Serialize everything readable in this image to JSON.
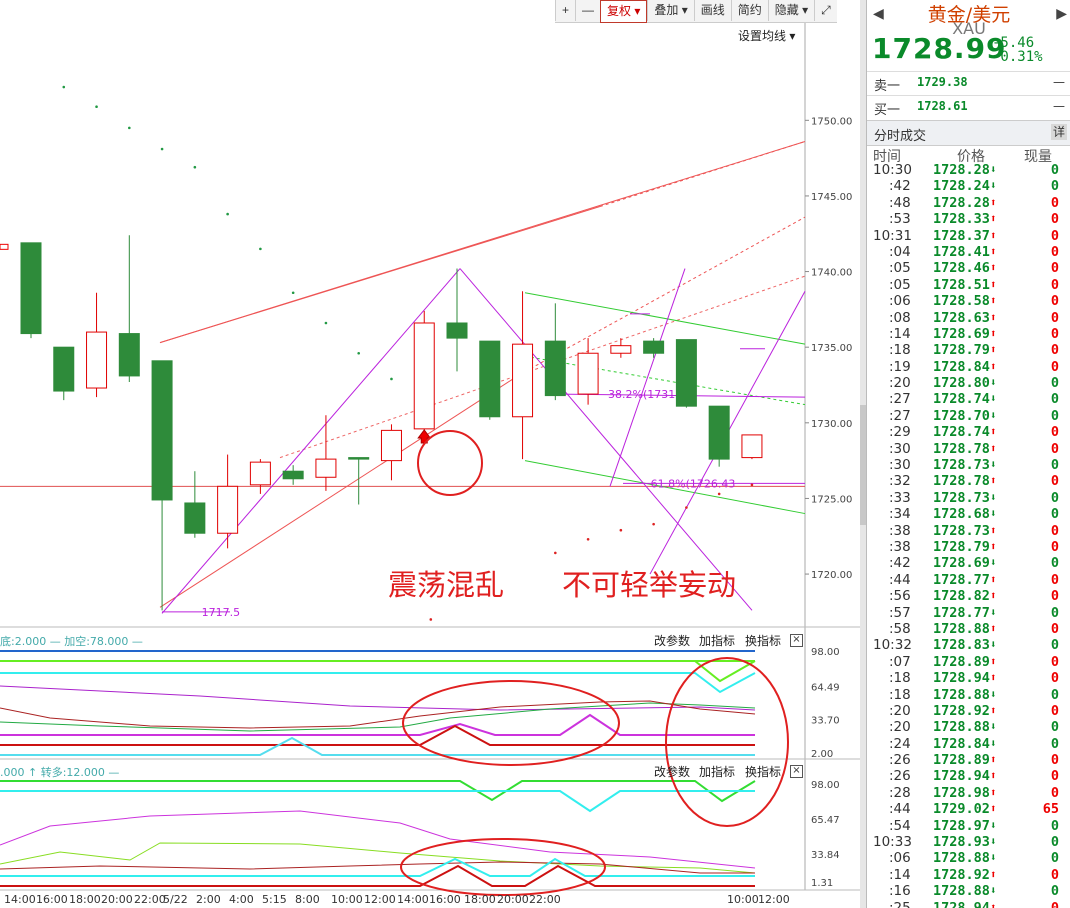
{
  "toolbar": {
    "items": [
      {
        "label": "+",
        "name": "zoom-in-button"
      },
      {
        "label": "—",
        "name": "zoom-out-button"
      },
      {
        "label": "复权 ▾",
        "name": "fuquan-button",
        "active": true
      },
      {
        "label": "叠加 ▾",
        "name": "overlay-button"
      },
      {
        "label": "画线",
        "name": "draw-line-button"
      },
      {
        "label": "简约",
        "name": "simple-button"
      },
      {
        "label": "隐藏 ▾",
        "name": "hide-button"
      },
      {
        "label": "⤢",
        "name": "fullscreen-icon"
      }
    ],
    "ma_setting": "设置均线 ▾"
  },
  "annotation_text": {
    "left": "震荡混乱",
    "right": "不可轻举妄动"
  },
  "chart_data": [
    {
      "type": "candlestick",
      "y_axis_ticks": [
        "1750.00",
        "1745.00",
        "1740.00",
        "1735.00",
        "1730.00",
        "1725.00",
        "1720.00"
      ],
      "ylim": [
        1716.5,
        1756.5
      ],
      "y_tick_values": [
        1750,
        1745,
        1740,
        1735,
        1730,
        1725,
        1720
      ],
      "candles": [
        {
          "o": 1741.9,
          "c": 1735.9,
          "h": 1741.9,
          "l": 1735.6
        },
        {
          "o": 1735.0,
          "c": 1732.1,
          "h": 1735.0,
          "l": 1731.5
        },
        {
          "o": 1732.3,
          "c": 1736.0,
          "h": 1738.6,
          "l": 1731.7
        },
        {
          "o": 1735.9,
          "c": 1733.1,
          "h": 1742.4,
          "l": 1732.7
        },
        {
          "o": 1734.1,
          "c": 1724.9,
          "h": 1734.1,
          "l": 1717.6
        },
        {
          "o": 1724.7,
          "c": 1722.7,
          "h": 1726.8,
          "l": 1722.4
        },
        {
          "o": 1722.7,
          "c": 1725.8,
          "h": 1727.9,
          "l": 1721.7
        },
        {
          "o": 1725.9,
          "c": 1727.4,
          "h": 1727.6,
          "l": 1725.3
        },
        {
          "o": 1726.8,
          "c": 1726.3,
          "h": 1727.2,
          "l": 1725.9
        },
        {
          "o": 1726.4,
          "c": 1727.6,
          "h": 1730.5,
          "l": 1725.5
        },
        {
          "o": 1727.7,
          "c": 1727.6,
          "h": 1727.7,
          "l": 1724.6
        },
        {
          "o": 1727.5,
          "c": 1729.5,
          "h": 1729.9,
          "l": 1726.2
        },
        {
          "o": 1729.6,
          "c": 1736.6,
          "h": 1737.4,
          "l": 1729.2
        },
        {
          "o": 1736.6,
          "c": 1735.6,
          "h": 1740.2,
          "l": 1733.4
        },
        {
          "o": 1735.4,
          "c": 1730.4,
          "h": 1735.4,
          "l": 1730.2
        },
        {
          "o": 1730.4,
          "c": 1735.2,
          "h": 1738.7,
          "l": 1727.6
        },
        {
          "o": 1735.4,
          "c": 1731.8,
          "h": 1737.9,
          "l": 1731.5
        },
        {
          "o": 1731.9,
          "c": 1734.6,
          "h": 1735.6,
          "l": 1731.2
        },
        {
          "o": 1734.6,
          "c": 1735.1,
          "h": 1735.6,
          "l": 1734.3
        },
        {
          "o": 1735.4,
          "c": 1734.6,
          "h": 1735.6,
          "l": 1734.3
        },
        {
          "o": 1735.5,
          "c": 1731.1,
          "h": 1735.5,
          "l": 1731.0
        },
        {
          "o": 1731.1,
          "c": 1727.6,
          "h": 1731.1,
          "l": 1727.1
        },
        {
          "o": 1727.7,
          "c": 1729.2,
          "h": 1729.2,
          "l": 1727.6
        }
      ],
      "sar_points": [
        [
          1,
          1752.2
        ],
        [
          2,
          1750.9
        ],
        [
          3,
          1749.5
        ],
        [
          4,
          1748.1
        ],
        [
          5,
          1746.9
        ],
        [
          6,
          1743.8
        ],
        [
          7,
          1741.5
        ],
        [
          8,
          1738.6
        ],
        [
          9,
          1736.6
        ],
        [
          10,
          1734.6
        ],
        [
          11,
          1732.9
        ],
        [
          12,
          1731.6
        ],
        [
          16,
          1721.4
        ],
        [
          17,
          1722.3
        ],
        [
          18,
          1722.9
        ],
        [
          19,
          1723.3
        ],
        [
          20,
          1724.4
        ],
        [
          21,
          1725.3
        ],
        [
          22,
          1725.9
        ]
      ],
      "horizontal_line": 1725.8,
      "texts": [
        {
          "text": "1717.5",
          "anchor": [
            5.3,
            1717.5
          ]
        },
        {
          "text": "38.2%(1731.7",
          "anchor": [
            17.7,
            1731.9
          ]
        },
        {
          "text": "61.8%(1726.43",
          "anchor": [
            19.0,
            1726.0
          ]
        }
      ]
    },
    {
      "type": "line",
      "title": "底:2.000 — 加空:78.000 —",
      "y_axis_ticks": [
        "98.00",
        "64.49",
        "33.70",
        "2.00"
      ],
      "buttons": [
        "改参数",
        "加指标",
        "换指标"
      ]
    },
    {
      "type": "line",
      "title": ".000 ↑ 转多:12.000 —",
      "y_axis_ticks": [
        "98.00",
        "65.47",
        "33.84",
        "1.31"
      ],
      "buttons": [
        "改参数",
        "加指标",
        "换指标"
      ]
    }
  ],
  "x_axis_labels": [
    "14:00",
    "16:00",
    "18:00",
    "20:00",
    "22:00",
    "5/22",
    "2:00",
    "4:00",
    "5:15",
    "8:00",
    "10:00",
    "12:00",
    "14:00",
    "16:00",
    "18:00",
    "20:00",
    "22:00",
    "10:00",
    "12:00"
  ],
  "quote": {
    "name": "黄金/美元",
    "code": "XAU",
    "price": "1728.99",
    "change": "-5.46",
    "change_pct": "-0.31%",
    "sell_label": "卖一",
    "sell_price": "1729.38",
    "sell_vol": "—",
    "buy_label": "买一",
    "buy_price": "1728.61",
    "buy_vol": "—"
  },
  "ticks_panel": {
    "title": "分时成交",
    "detail": "详",
    "col_time": "时间",
    "col_price": "价格",
    "col_vol": "现量",
    "rows": [
      {
        "time": "10:30",
        "price": "1728.28",
        "dir": "down",
        "vol": "0"
      },
      {
        "time": ":42",
        "price": "1728.24",
        "dir": "down",
        "vol": "0"
      },
      {
        "time": ":48",
        "price": "1728.28",
        "dir": "up",
        "vol": "0"
      },
      {
        "time": ":53",
        "price": "1728.33",
        "dir": "up",
        "vol": "0"
      },
      {
        "time": "10:31",
        "price": "1728.37",
        "dir": "up",
        "vol": "0"
      },
      {
        "time": ":04",
        "price": "1728.41",
        "dir": "up",
        "vol": "0"
      },
      {
        "time": ":05",
        "price": "1728.46",
        "dir": "up",
        "vol": "0"
      },
      {
        "time": ":05",
        "price": "1728.51",
        "dir": "up",
        "vol": "0"
      },
      {
        "time": ":06",
        "price": "1728.58",
        "dir": "up",
        "vol": "0"
      },
      {
        "time": ":08",
        "price": "1728.63",
        "dir": "up",
        "vol": "0"
      },
      {
        "time": ":14",
        "price": "1728.69",
        "dir": "up",
        "vol": "0"
      },
      {
        "time": ":18",
        "price": "1728.79",
        "dir": "up",
        "vol": "0"
      },
      {
        "time": ":19",
        "price": "1728.84",
        "dir": "up",
        "vol": "0"
      },
      {
        "time": ":20",
        "price": "1728.80",
        "dir": "down",
        "vol": "0"
      },
      {
        "time": ":27",
        "price": "1728.74",
        "dir": "down",
        "vol": "0"
      },
      {
        "time": ":27",
        "price": "1728.70",
        "dir": "down",
        "vol": "0"
      },
      {
        "time": ":29",
        "price": "1728.74",
        "dir": "up",
        "vol": "0"
      },
      {
        "time": ":30",
        "price": "1728.78",
        "dir": "up",
        "vol": "0"
      },
      {
        "time": ":30",
        "price": "1728.73",
        "dir": "down",
        "vol": "0"
      },
      {
        "time": ":32",
        "price": "1728.78",
        "dir": "up",
        "vol": "0"
      },
      {
        "time": ":33",
        "price": "1728.73",
        "dir": "down",
        "vol": "0"
      },
      {
        "time": ":34",
        "price": "1728.68",
        "dir": "down",
        "vol": "0"
      },
      {
        "time": ":38",
        "price": "1728.73",
        "dir": "up",
        "vol": "0"
      },
      {
        "time": ":38",
        "price": "1728.79",
        "dir": "up",
        "vol": "0"
      },
      {
        "time": ":42",
        "price": "1728.69",
        "dir": "down",
        "vol": "0"
      },
      {
        "time": ":44",
        "price": "1728.77",
        "dir": "up",
        "vol": "0"
      },
      {
        "time": ":56",
        "price": "1728.82",
        "dir": "up",
        "vol": "0"
      },
      {
        "time": ":57",
        "price": "1728.77",
        "dir": "down",
        "vol": "0"
      },
      {
        "time": ":58",
        "price": "1728.88",
        "dir": "up",
        "vol": "0"
      },
      {
        "time": "10:32",
        "price": "1728.83",
        "dir": "down",
        "vol": "0"
      },
      {
        "time": ":07",
        "price": "1728.89",
        "dir": "up",
        "vol": "0"
      },
      {
        "time": ":18",
        "price": "1728.94",
        "dir": "up",
        "vol": "0"
      },
      {
        "time": ":18",
        "price": "1728.88",
        "dir": "down",
        "vol": "0"
      },
      {
        "time": ":20",
        "price": "1728.92",
        "dir": "up",
        "vol": "0"
      },
      {
        "time": ":20",
        "price": "1728.88",
        "dir": "down",
        "vol": "0"
      },
      {
        "time": ":24",
        "price": "1728.84",
        "dir": "down",
        "vol": "0"
      },
      {
        "time": ":26",
        "price": "1728.89",
        "dir": "up",
        "vol": "0"
      },
      {
        "time": ":26",
        "price": "1728.94",
        "dir": "up",
        "vol": "0"
      },
      {
        "time": ":28",
        "price": "1728.98",
        "dir": "up",
        "vol": "0"
      },
      {
        "time": ":44",
        "price": "1729.02",
        "dir": "up",
        "vol": "65"
      },
      {
        "time": ":54",
        "price": "1728.97",
        "dir": "down",
        "vol": "0"
      },
      {
        "time": "10:33",
        "price": "1728.93",
        "dir": "down",
        "vol": "0"
      },
      {
        "time": ":06",
        "price": "1728.88",
        "dir": "down",
        "vol": "0"
      },
      {
        "time": ":14",
        "price": "1728.92",
        "dir": "up",
        "vol": "0"
      },
      {
        "time": ":16",
        "price": "1728.88",
        "dir": "down",
        "vol": "0"
      },
      {
        "time": ":25",
        "price": "1728.94",
        "dir": "up",
        "vol": "0"
      }
    ]
  },
  "colors": {
    "up": "#e00000",
    "down": "#2e8b3a",
    "price_green": "#0a8a2a",
    "annotation_red": "#e02020",
    "fib_purple": "#bb22dd"
  }
}
